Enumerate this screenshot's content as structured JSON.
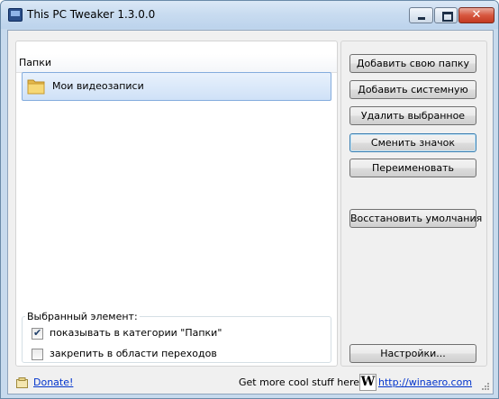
{
  "window": {
    "title": "This PC Tweaker 1.3.0.0",
    "close_glyph": "✕"
  },
  "list": {
    "header": "Папки",
    "items": [
      {
        "label": "Мои видеозаписи",
        "icon": "folder-icon",
        "selected": true
      }
    ]
  },
  "selected_group": {
    "title": "Выбранный элемент:",
    "options": [
      {
        "label": "показывать в категории \"Папки\"",
        "checked": true
      },
      {
        "label": "закрепить в области переходов",
        "checked": false
      }
    ]
  },
  "buttons": {
    "add_own": "Добавить свою папку",
    "add_system": "Добавить системную",
    "delete_selected": "Удалить выбранное",
    "change_icon": "Сменить значок",
    "rename": "Переименовать",
    "restore_defaults": "Восстановить умолчания",
    "settings": "Настройки..."
  },
  "footer": {
    "donate": "Donate!",
    "promo": "Get more cool stuff here:",
    "logo_letter": "W",
    "url": "http://winaero.com"
  },
  "colors": {
    "link": "#0033cc",
    "selection": "#cfe1f7",
    "close_button": "#c33a22"
  }
}
